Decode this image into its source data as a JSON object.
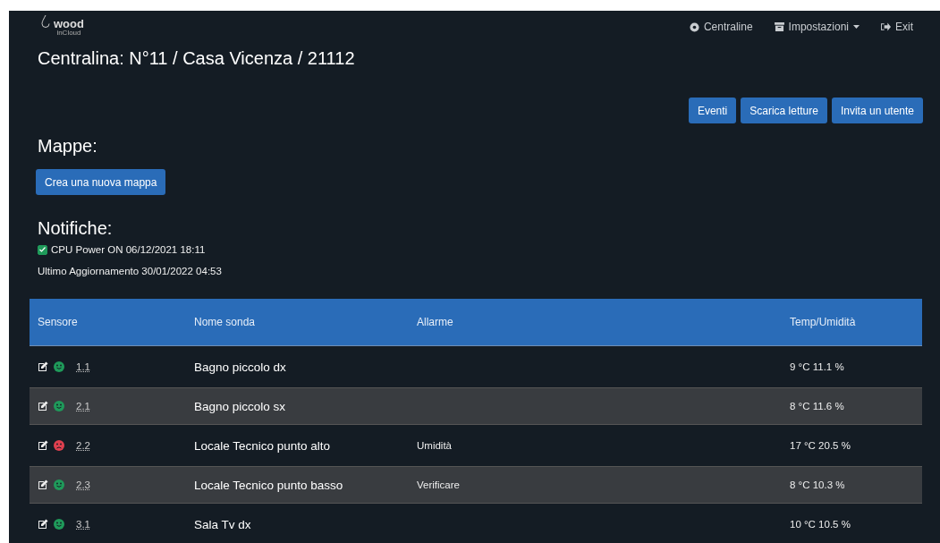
{
  "logo": {
    "name": "wood",
    "tagline": "inCloud"
  },
  "nav": [
    {
      "kind": "gear",
      "label": "Centraline"
    },
    {
      "kind": "archive",
      "label": "Impostazioni",
      "dropdown": true
    },
    {
      "kind": "exit",
      "label": "Exit"
    }
  ],
  "title": "Centralina: N°11 / Casa Vicenza / 21112",
  "actions": [
    "Eventi",
    "Scarica letture",
    "Invita un utente"
  ],
  "maps": {
    "heading": "Mappe:",
    "button": "Crea una nuova mappa"
  },
  "notifications": {
    "heading": "Notifiche:",
    "items": [
      {
        "checked": true,
        "text": "CPU Power ON 06/12/2021 18:11"
      }
    ],
    "updated": "Ultimo Aggiornamento 30/01/2022 04:53"
  },
  "table": {
    "columns": [
      "Sensore",
      "Nome sonda",
      "Allarme",
      "Temp/Umidità"
    ],
    "rows": [
      {
        "kind": "ok",
        "sensor": "1.1",
        "name": "Bagno piccolo dx",
        "reading": "9 °C 11.1 %"
      },
      {
        "kind": "ok",
        "sensor": "2.1",
        "name": "Bagno piccolo sx",
        "reading": "8 °C 11.6 %"
      },
      {
        "kind": "alarm",
        "sensor": "2.2",
        "name": "Locale Tecnico punto alto",
        "alarm": "Umidità",
        "reading": "17 °C 20.5 %"
      },
      {
        "kind": "ok",
        "sensor": "2.3",
        "name": "Locale Tecnico punto basso",
        "alarm": "Verificare",
        "reading": "8 °C 10.3 %"
      },
      {
        "kind": "ok",
        "sensor": "3.1",
        "name": "Sala Tv dx",
        "reading": "10 °C 10.5 %"
      }
    ]
  }
}
